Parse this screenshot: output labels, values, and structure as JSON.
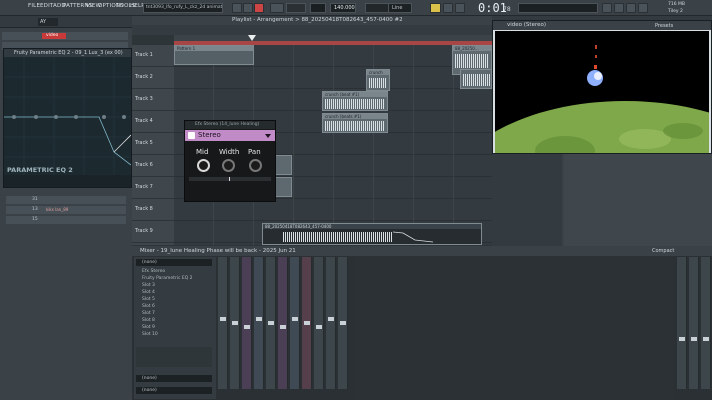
{
  "menubar": {
    "items": [
      "FILE",
      "EDIT",
      "ADD",
      "PATTERNS",
      "VIEW",
      "OPTIONS",
      "TOOLS",
      "HELP"
    ],
    "project_file": "tnt3093_lfo_rufy_L_ckz_2d animation.flp",
    "pattern": "AY",
    "tempo": "140.000",
    "snap": "Line",
    "time_main": "0:01",
    "time_frac": "78",
    "cpu_label": "716 MB",
    "poly_label": "Tiley 2"
  },
  "channel_rack": {
    "selected_label": "video",
    "mixer_track_1": "31",
    "mixer_track_2": "13",
    "mixer_track_3": "15",
    "row_label_1": "kiks lan_89",
    "eq_title": "Fruity Parametric EQ 2 - 09_1 Lux_3 (ex 00)",
    "eq_logo": "PARAMETRIC EQ 2"
  },
  "playlist": {
    "title": "Playlist - Arrangement > 88_20250418T082643_457-0400 #2",
    "tracks": [
      "Track 1",
      "Track 2",
      "Track 3",
      "Track 4",
      "Track 5",
      "Track 6",
      "Track 7",
      "Track 8",
      "Track 9"
    ],
    "clips": {
      "pattern": "Pattern 1",
      "c1": "88_20250...",
      "c2": "crunch",
      "c3": "crunch (beat #1)",
      "c4": "crunch (beats #1)",
      "c5": "88_20250418T082643_457-0400"
    }
  },
  "stereo_plugin": {
    "window_title": "Efx Stereo (14_lune Healing)",
    "name": "Stereo",
    "knobs": [
      "Mid",
      "Width",
      "Pan"
    ]
  },
  "video_window": {
    "title": "video (Stereo)",
    "tab": "Presets"
  },
  "mixer": {
    "title": "Mixer - 19_lune Healing Phase will be back - 2025 Jun 21",
    "compact_label": "Compact",
    "slot_none": "(none)",
    "fx_slots": [
      "Efx Stereo",
      "Fruity Parametric EQ 2",
      "Slot 3",
      "Slot 4",
      "Slot 5",
      "Slot 6",
      "Slot 7",
      "Slot 8",
      "Slot 9",
      "Slot 10"
    ],
    "bottom_none_1": "(none)",
    "bottom_none_2": "(none)"
  }
}
